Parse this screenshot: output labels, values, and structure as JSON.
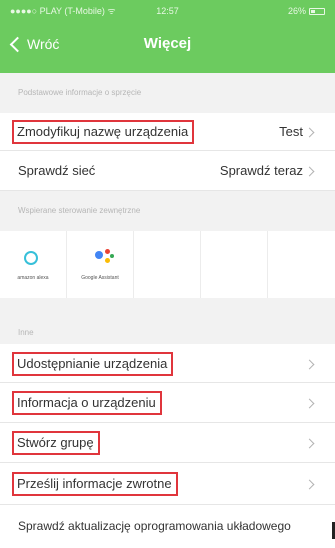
{
  "status_bar": {
    "carrier": "●●●●○ PLAY (T-Mobile) ᯤ",
    "time": "12:57",
    "battery": "26%"
  },
  "nav": {
    "back_label": "Wróć",
    "title": "Więcej"
  },
  "sections": {
    "basic_info": "Podstawowe informacje o sprzęcie",
    "external_control": "Wspierane sterowanie zewnętrzne",
    "other": "Inne"
  },
  "basic_rows": [
    {
      "label": "Zmodyfikuj nazwę urządzenia",
      "value": "Test"
    },
    {
      "label": "Sprawdź sieć",
      "value": "Sprawdź teraz"
    }
  ],
  "services": [
    {
      "name": "amazon alexa",
      "icon": "alexa-icon"
    },
    {
      "name": "Google Assistant",
      "icon": "google-assistant-icon"
    }
  ],
  "other_rows": [
    {
      "label": "Udostępnianie urządzenia"
    },
    {
      "label": "Informacja o urządzeniu"
    },
    {
      "label": "Stwórz grupę"
    },
    {
      "label": "Prześlij informacje zwrotne"
    },
    {
      "label": "Sprawdź aktualizację oprogramowania układowego"
    }
  ],
  "colors": {
    "header_green": "#6ccb5f",
    "highlight_red": "#e0353c",
    "section_gray": "#f2f2f2",
    "alexa_blue": "#37c0d9"
  }
}
